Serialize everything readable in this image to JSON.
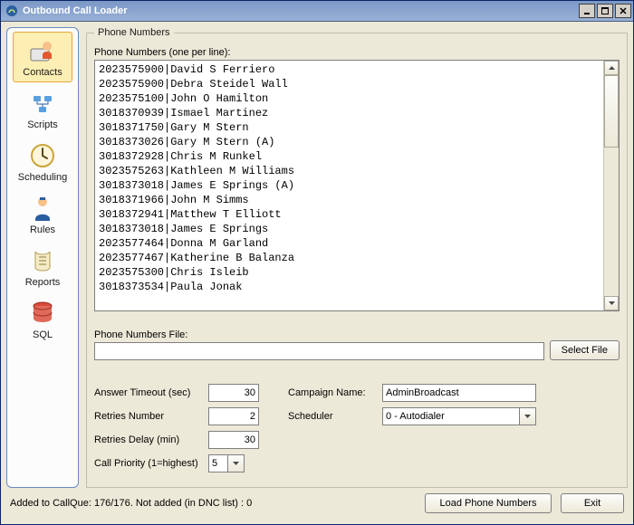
{
  "window": {
    "title": "Outbound Call Loader"
  },
  "sidebar": {
    "items": [
      {
        "label": "Contacts",
        "selected": true
      },
      {
        "label": "Scripts",
        "selected": false
      },
      {
        "label": "Scheduling",
        "selected": false
      },
      {
        "label": "Rules",
        "selected": false
      },
      {
        "label": "Reports",
        "selected": false
      },
      {
        "label": "SQL",
        "selected": false
      }
    ]
  },
  "group": {
    "legend": "Phone Numbers",
    "list_label": "Phone Numbers (one per line):",
    "entries": [
      "2023575900|David S Ferriero",
      "2023575900|Debra Steidel Wall",
      "2023575100|John O Hamilton",
      "3018370939|Ismael Martinez",
      "3018371750|Gary M Stern",
      "3018373026|Gary M Stern (A)",
      "3018372928|Chris M Runkel",
      "3023575263|Kathleen M Williams",
      "3018373018|James E Springs (A)",
      "3018371966|John M Simms",
      "3018372941|Matthew T Elliott",
      "3018373018|James E Springs",
      "2023577464|Donna M Garland",
      "2023577467|Katherine B Balanza",
      "2023575300|Chris Isleib",
      "3018373534|Paula Jonak"
    ],
    "file_label": "Phone Numbers File:",
    "file_value": "",
    "select_file_btn": "Select File",
    "settings": {
      "answer_timeout_label": "Answer Timeout (sec)",
      "answer_timeout_value": "30",
      "retries_number_label": "Retries Number",
      "retries_number_value": "2",
      "retries_delay_label": "Retries Delay (min)",
      "retries_delay_value": "30",
      "call_priority_label": "Call Priority (1=highest)",
      "call_priority_value": "5",
      "campaign_name_label": "Campaign Name:",
      "campaign_name_value": "AdminBroadcast",
      "scheduler_label": "Scheduler",
      "scheduler_value": "0 - Autodialer"
    }
  },
  "footer": {
    "status": "Added to CallQue: 176/176. Not added (in DNC list) : 0",
    "load_btn": "Load Phone Numbers",
    "exit_btn": "Exit"
  }
}
